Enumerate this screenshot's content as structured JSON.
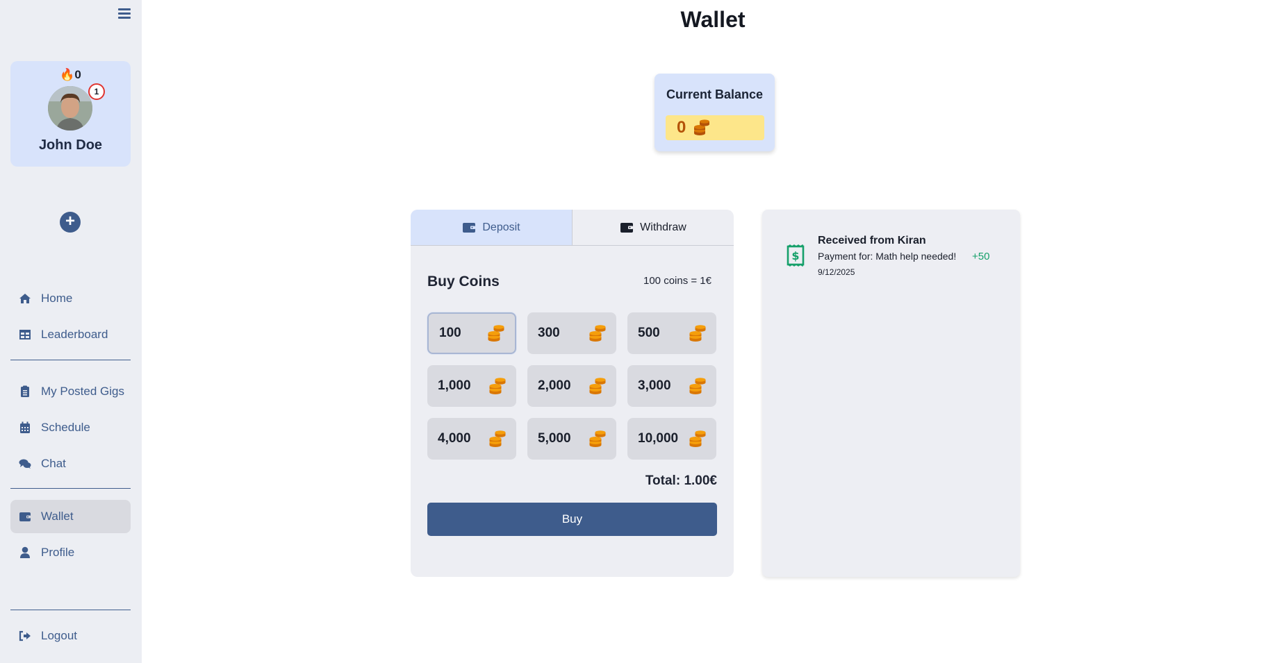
{
  "page": {
    "title": "Wallet"
  },
  "sidebar": {
    "streak": "🔥0",
    "notification_count": "1",
    "user_name": "John Doe",
    "add_label": "+",
    "nav": [
      {
        "label": "Home",
        "icon": "home-icon"
      },
      {
        "label": "Leaderboard",
        "icon": "table-icon"
      },
      {
        "label": "My Posted Gigs",
        "icon": "clipboard-icon"
      },
      {
        "label": "Schedule",
        "icon": "calendar-icon"
      },
      {
        "label": "Chat",
        "icon": "chat-icon"
      },
      {
        "label": "Wallet",
        "icon": "wallet-icon",
        "active": true
      },
      {
        "label": "Profile",
        "icon": "user-icon"
      },
      {
        "label": "Logout",
        "icon": "logout-icon"
      }
    ]
  },
  "balance": {
    "title": "Current Balance",
    "value": "0"
  },
  "wallet_panel": {
    "tabs": {
      "deposit": "Deposit",
      "withdraw": "Withdraw"
    },
    "buy_title": "Buy Coins",
    "rate": "100 coins = 1€",
    "options": [
      "100",
      "300",
      "500",
      "1,000",
      "2,000",
      "3,000",
      "4,000",
      "5,000",
      "10,000"
    ],
    "selected_option": "100",
    "total": "Total: 1.00€",
    "buy_label": "Buy"
  },
  "transactions": [
    {
      "title": "Received from Kiran",
      "description": "Payment for: Math help needed!",
      "amount": "+50",
      "date": "9/12/2025"
    }
  ],
  "colors": {
    "primary": "#3e5c8c",
    "active_bg": "#d8e3fb",
    "coin": "#f59e0b",
    "coin_dark": "#b45309",
    "positive": "#16a06a"
  }
}
